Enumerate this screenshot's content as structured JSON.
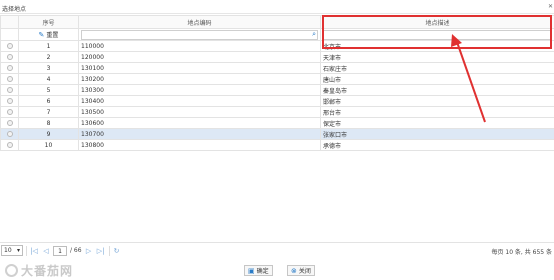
{
  "window": {
    "title": "选择地点",
    "close_glyph": "✕"
  },
  "grid": {
    "columns": {
      "index": "序号",
      "code": "地点编码",
      "name": "地点描述"
    },
    "filter": {
      "reset_label": "重置",
      "code_value": "",
      "name_value": ""
    },
    "selected_row": 8,
    "rows": [
      {
        "index": "1",
        "code": "110000",
        "name": "北京市"
      },
      {
        "index": "2",
        "code": "120000",
        "name": "天津市"
      },
      {
        "index": "3",
        "code": "130100",
        "name": "石家庄市"
      },
      {
        "index": "4",
        "code": "130200",
        "name": "唐山市"
      },
      {
        "index": "5",
        "code": "130300",
        "name": "秦皇岛市"
      },
      {
        "index": "6",
        "code": "130400",
        "name": "邯郸市"
      },
      {
        "index": "7",
        "code": "130500",
        "name": "邢台市"
      },
      {
        "index": "8",
        "code": "130600",
        "name": "保定市"
      },
      {
        "index": "9",
        "code": "130700",
        "name": "张家口市"
      },
      {
        "index": "10",
        "code": "130800",
        "name": "承德市"
      }
    ]
  },
  "pager": {
    "page_size": "10",
    "current_page": "1",
    "total_pages": "/ 66",
    "info": "每页 10 条, 共 655 条"
  },
  "footer": {
    "watermark": "大番茄网",
    "confirm_label": "确定",
    "close_label": "关闭"
  },
  "colors": {
    "annotation": "#e03131",
    "accent": "#2a7cc7",
    "selected_row": "#dde8f5"
  }
}
